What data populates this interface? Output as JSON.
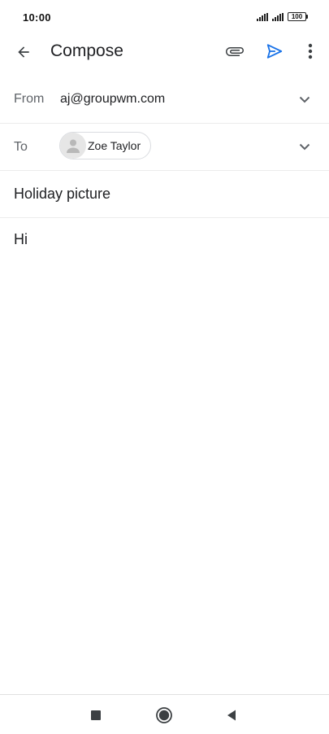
{
  "status_bar": {
    "time": "10:00",
    "battery": "100"
  },
  "app_bar": {
    "title": "Compose",
    "back_icon": "arrow-back-icon",
    "attach_icon": "paperclip-icon",
    "send_icon": "send-icon",
    "more_icon": "more-vert-icon"
  },
  "from": {
    "label": "From",
    "value": "aj@groupwm.com"
  },
  "to": {
    "label": "To",
    "recipients": [
      {
        "name": "Zoe Taylor"
      }
    ]
  },
  "subject": "Holiday picture",
  "body": "Hi",
  "colors": {
    "accent": "#1a73e8",
    "text": "#202124",
    "label": "#5f6368",
    "divider": "#ececec"
  },
  "nav_bar": {
    "icons": [
      "recents-square-icon",
      "home-circle-icon",
      "back-triangle-icon"
    ]
  }
}
